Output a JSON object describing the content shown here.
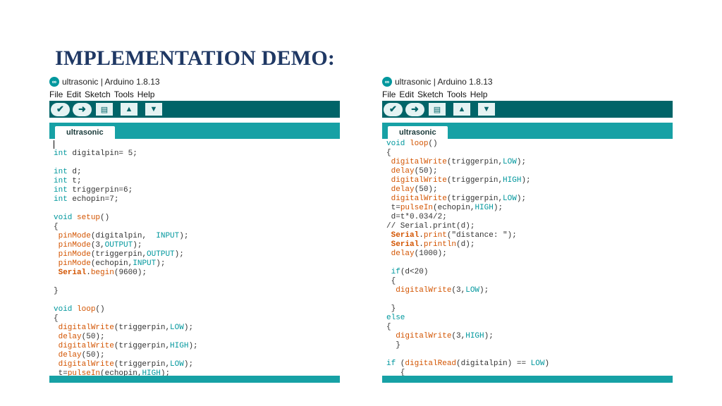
{
  "slide": {
    "title": "IMPLEMENTATION DEMO:"
  },
  "left_window": {
    "title": "ultrasonic | Arduino 1.8.13",
    "menu": [
      "File",
      "Edit",
      "Sketch",
      "Tools",
      "Help"
    ],
    "toolbar": [
      {
        "name": "verify-button",
        "glyph": "✔"
      },
      {
        "name": "upload-button",
        "glyph": "➜"
      },
      {
        "name": "new-button",
        "glyph": "▤"
      },
      {
        "name": "open-button",
        "glyph": "▲"
      },
      {
        "name": "save-button",
        "glyph": "▼"
      }
    ],
    "tab": "ultrasonic",
    "code": [
      [
        [
          "p",
          ""
        ]
      ],
      [
        [
          "k",
          "int"
        ],
        [
          "p",
          " digitalpin= 5;"
        ]
      ],
      [
        [
          "p",
          ""
        ]
      ],
      [
        [
          "k",
          "int"
        ],
        [
          "p",
          " d;"
        ]
      ],
      [
        [
          "k",
          "int"
        ],
        [
          "p",
          " t;"
        ]
      ],
      [
        [
          "k",
          "int"
        ],
        [
          "p",
          " triggerpin=6;"
        ]
      ],
      [
        [
          "k",
          "int"
        ],
        [
          "p",
          " echopin=7;"
        ]
      ],
      [
        [
          "p",
          ""
        ]
      ],
      [
        [
          "k",
          "void"
        ],
        [
          "p",
          " "
        ],
        [
          "f",
          "setup"
        ],
        [
          "p",
          "()"
        ]
      ],
      [
        [
          "p",
          "{"
        ]
      ],
      [
        [
          "p",
          " "
        ],
        [
          "f",
          "pinMode"
        ],
        [
          "p",
          "(digitalpin,  "
        ],
        [
          "c",
          "INPUT"
        ],
        [
          "p",
          ");"
        ]
      ],
      [
        [
          "p",
          " "
        ],
        [
          "f",
          "pinMode"
        ],
        [
          "p",
          "(3,"
        ],
        [
          "c",
          "OUTPUT"
        ],
        [
          "p",
          ");"
        ]
      ],
      [
        [
          "p",
          " "
        ],
        [
          "f",
          "pinMode"
        ],
        [
          "p",
          "(triggerpin,"
        ],
        [
          "c",
          "OUTPUT"
        ],
        [
          "p",
          ");"
        ]
      ],
      [
        [
          "p",
          " "
        ],
        [
          "f",
          "pinMode"
        ],
        [
          "p",
          "(echopin,"
        ],
        [
          "c",
          "INPUT"
        ],
        [
          "p",
          ");"
        ]
      ],
      [
        [
          "p",
          " "
        ],
        [
          "o",
          "Serial"
        ],
        [
          "p",
          "."
        ],
        [
          "f",
          "begin"
        ],
        [
          "p",
          "(9600);"
        ]
      ],
      [
        [
          "p",
          ""
        ]
      ],
      [
        [
          "p",
          "}"
        ]
      ],
      [
        [
          "p",
          ""
        ]
      ],
      [
        [
          "k",
          "void"
        ],
        [
          "p",
          " "
        ],
        [
          "f",
          "loop"
        ],
        [
          "p",
          "()"
        ]
      ],
      [
        [
          "p",
          "{"
        ]
      ],
      [
        [
          "p",
          " "
        ],
        [
          "f",
          "digitalWrite"
        ],
        [
          "p",
          "(triggerpin,"
        ],
        [
          "c",
          "LOW"
        ],
        [
          "p",
          ");"
        ]
      ],
      [
        [
          "p",
          " "
        ],
        [
          "f",
          "delay"
        ],
        [
          "p",
          "(50);"
        ]
      ],
      [
        [
          "p",
          " "
        ],
        [
          "f",
          "digitalWrite"
        ],
        [
          "p",
          "(triggerpin,"
        ],
        [
          "c",
          "HIGH"
        ],
        [
          "p",
          ");"
        ]
      ],
      [
        [
          "p",
          " "
        ],
        [
          "f",
          "delay"
        ],
        [
          "p",
          "(50);"
        ]
      ],
      [
        [
          "p",
          " "
        ],
        [
          "f",
          "digitalWrite"
        ],
        [
          "p",
          "(triggerpin,"
        ],
        [
          "c",
          "LOW"
        ],
        [
          "p",
          ");"
        ]
      ],
      [
        [
          "p",
          " t="
        ],
        [
          "f",
          "pulseIn"
        ],
        [
          "p",
          "(echopin,"
        ],
        [
          "c",
          "HIGH"
        ],
        [
          "p",
          ");"
        ]
      ]
    ]
  },
  "right_window": {
    "title": "ultrasonic | Arduino 1.8.13",
    "menu": [
      "File",
      "Edit",
      "Sketch",
      "Tools",
      "Help"
    ],
    "toolbar": [
      {
        "name": "verify-button",
        "glyph": "✔"
      },
      {
        "name": "upload-button",
        "glyph": "➜"
      },
      {
        "name": "new-button",
        "glyph": "▤"
      },
      {
        "name": "open-button",
        "glyph": "▲"
      },
      {
        "name": "save-button",
        "glyph": "▼"
      }
    ],
    "tab": "ultrasonic",
    "code": [
      [
        [
          "k",
          "void"
        ],
        [
          "p",
          " "
        ],
        [
          "f",
          "loop"
        ],
        [
          "p",
          "()"
        ]
      ],
      [
        [
          "p",
          "{"
        ]
      ],
      [
        [
          "p",
          " "
        ],
        [
          "f",
          "digitalWrite"
        ],
        [
          "p",
          "(triggerpin,"
        ],
        [
          "c",
          "LOW"
        ],
        [
          "p",
          ");"
        ]
      ],
      [
        [
          "p",
          " "
        ],
        [
          "f",
          "delay"
        ],
        [
          "p",
          "(50);"
        ]
      ],
      [
        [
          "p",
          " "
        ],
        [
          "f",
          "digitalWrite"
        ],
        [
          "p",
          "(triggerpin,"
        ],
        [
          "c",
          "HIGH"
        ],
        [
          "p",
          ");"
        ]
      ],
      [
        [
          "p",
          " "
        ],
        [
          "f",
          "delay"
        ],
        [
          "p",
          "(50);"
        ]
      ],
      [
        [
          "p",
          " "
        ],
        [
          "f",
          "digitalWrite"
        ],
        [
          "p",
          "(triggerpin,"
        ],
        [
          "c",
          "LOW"
        ],
        [
          "p",
          ");"
        ]
      ],
      [
        [
          "p",
          " t="
        ],
        [
          "f",
          "pulseIn"
        ],
        [
          "p",
          "(echopin,"
        ],
        [
          "c",
          "HIGH"
        ],
        [
          "p",
          ");"
        ]
      ],
      [
        [
          "p",
          " d=t*0.034/2;"
        ]
      ],
      [
        [
          "p",
          "// Serial.print(d);"
        ]
      ],
      [
        [
          "p",
          " "
        ],
        [
          "o",
          "Serial"
        ],
        [
          "p",
          "."
        ],
        [
          "f",
          "print"
        ],
        [
          "p",
          "(\"distance: \");"
        ]
      ],
      [
        [
          "p",
          " "
        ],
        [
          "o",
          "Serial"
        ],
        [
          "p",
          "."
        ],
        [
          "f",
          "println"
        ],
        [
          "p",
          "(d);"
        ]
      ],
      [
        [
          "p",
          " "
        ],
        [
          "f",
          "delay"
        ],
        [
          "p",
          "(1000);"
        ]
      ],
      [
        [
          "p",
          ""
        ]
      ],
      [
        [
          "p",
          " "
        ],
        [
          "k",
          "if"
        ],
        [
          "p",
          "(d<20)"
        ]
      ],
      [
        [
          "p",
          " {"
        ]
      ],
      [
        [
          "p",
          "  "
        ],
        [
          "f",
          "digitalWrite"
        ],
        [
          "p",
          "(3,"
        ],
        [
          "c",
          "LOW"
        ],
        [
          "p",
          ");"
        ]
      ],
      [
        [
          "p",
          ""
        ]
      ],
      [
        [
          "p",
          " }"
        ]
      ],
      [
        [
          "k",
          "else"
        ]
      ],
      [
        [
          "p",
          "{"
        ]
      ],
      [
        [
          "p",
          "  "
        ],
        [
          "f",
          "digitalWrite"
        ],
        [
          "p",
          "(3,"
        ],
        [
          "c",
          "HIGH"
        ],
        [
          "p",
          ");"
        ]
      ],
      [
        [
          "p",
          "  }"
        ]
      ],
      [
        [
          "p",
          ""
        ]
      ],
      [
        [
          "k",
          "if"
        ],
        [
          "p",
          " ("
        ],
        [
          "f",
          "digitalRead"
        ],
        [
          "p",
          "(digitalpin) == "
        ],
        [
          "c",
          "LOW"
        ],
        [
          "p",
          ")"
        ]
      ],
      [
        [
          "p",
          "   {"
        ]
      ]
    ]
  },
  "colors": {
    "toolbar": "#006468",
    "tabbar": "#17a1a5",
    "keyword": "#00979d",
    "function": "#d35400",
    "title": "#1f3864"
  }
}
